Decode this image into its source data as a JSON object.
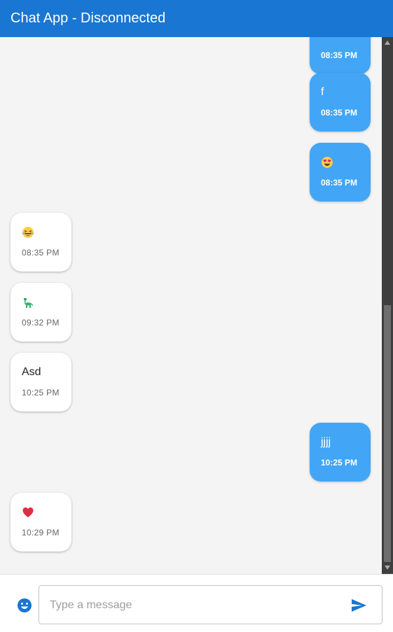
{
  "header": {
    "title": "Chat App - Disconnected"
  },
  "messages": [
    {
      "direction": "sent",
      "text": "",
      "time": "08:35 PM"
    },
    {
      "direction": "sent",
      "text": "f",
      "time": "08:35 PM"
    },
    {
      "direction": "sent",
      "icon": "heart-eyes-emoji",
      "time": "08:35 PM"
    },
    {
      "direction": "received",
      "icon": "laughing-tears-emoji",
      "time": "08:35 PM"
    },
    {
      "direction": "received",
      "icon": "dinosaur-emoji",
      "time": "09:32 PM"
    },
    {
      "direction": "received",
      "text": "Asd",
      "time": "10:25 PM"
    },
    {
      "direction": "sent",
      "text": "jjjj",
      "time": "10:25 PM"
    },
    {
      "direction": "received",
      "icon": "red-heart-emoji",
      "time": "10:29 PM"
    }
  ],
  "composer": {
    "placeholder": "Type a message",
    "value": "",
    "emoji_icon": "smiley-icon",
    "send_icon": "send-icon"
  },
  "colors": {
    "header": "#1976d2",
    "sent_bubble": "#42a5f5",
    "received_bubble": "#ffffff",
    "accent": "#1976d2"
  }
}
